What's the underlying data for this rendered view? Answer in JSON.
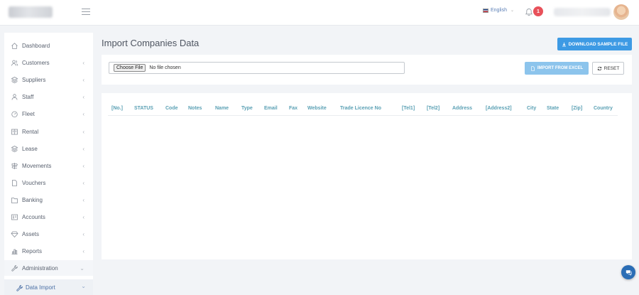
{
  "header": {
    "language": "English",
    "notification_count": "1"
  },
  "sidebar": {
    "items": [
      {
        "label": "Dashboard",
        "icon": "home-icon",
        "has_arrow": false
      },
      {
        "label": "Customers",
        "icon": "users-icon",
        "has_arrow": true
      },
      {
        "label": "Suppliers",
        "icon": "layers-icon",
        "has_arrow": true
      },
      {
        "label": "Staff",
        "icon": "user-group-icon",
        "has_arrow": true
      },
      {
        "label": "Fleet",
        "icon": "speedometer-icon",
        "has_arrow": true
      },
      {
        "label": "Rental",
        "icon": "book-icon",
        "has_arrow": true
      },
      {
        "label": "Lease",
        "icon": "layers-alt-icon",
        "has_arrow": true
      },
      {
        "label": "Movements",
        "icon": "signpost-icon",
        "has_arrow": true
      },
      {
        "label": "Vouchers",
        "icon": "file-icon",
        "has_arrow": true
      },
      {
        "label": "Banking",
        "icon": "folder-icon",
        "has_arrow": true
      },
      {
        "label": "Accounts",
        "icon": "id-card-icon",
        "has_arrow": true
      },
      {
        "label": "Assets",
        "icon": "diamond-icon",
        "has_arrow": true
      },
      {
        "label": "Reports",
        "icon": "bar-chart-icon",
        "has_arrow": true
      },
      {
        "label": "Administration",
        "icon": "wrench-icon",
        "has_arrow": true
      }
    ],
    "sub_item": {
      "label": "Data Import",
      "icon": "wrench-icon"
    }
  },
  "main": {
    "title": "Import Companies Data",
    "download_label": "DOWNLOAD SAMPLE FILE",
    "choose_file_label": "Choose File",
    "file_status": "No file chosen",
    "import_label": "IMPORT FROM EXCEL",
    "reset_label": "RESET",
    "columns": [
      "[No.]",
      "STATUS",
      "Code",
      "Notes",
      "Name",
      "Type",
      "Email",
      "Fax",
      "Website",
      "Trade Licence No",
      "[Tel1]",
      "[Tel2]",
      "Address",
      "[Address2]",
      "City",
      "State",
      "[Zip]",
      "Country"
    ]
  },
  "colors": {
    "accent": "#3d9ae4",
    "import_button": "#8cc4ec",
    "badge": "#e8515a",
    "header_text": "#5aa0b4"
  }
}
